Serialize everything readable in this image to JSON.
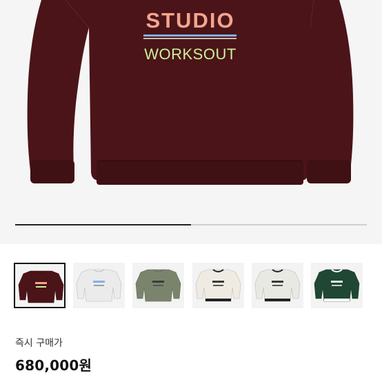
{
  "hero": {
    "print_line1": "STUDIO",
    "print_line2": "WORKSOUT",
    "colors": {
      "sweatshirt": "#4b1418",
      "line1": "#f3a58e",
      "line2": "#cdf09a",
      "divider_blue": "#7fb2e8",
      "divider_white": "#f4eada"
    }
  },
  "gallery": {
    "progress": 0.5,
    "selected_index": 0,
    "thumbnails": [
      {
        "color": "#4b1418",
        "name": "burgundy"
      },
      {
        "color": "#ebebeb",
        "name": "white"
      },
      {
        "color": "#7a846c",
        "name": "khaki"
      },
      {
        "color": "#efebe3",
        "name": "cream-black-trim"
      },
      {
        "color": "#e9e9e4",
        "name": "light-gray-dark-trim"
      },
      {
        "color": "#1f4734",
        "name": "green-white-trim"
      }
    ]
  },
  "purchase": {
    "label": "즉시 구매가",
    "price": "680,000원"
  }
}
